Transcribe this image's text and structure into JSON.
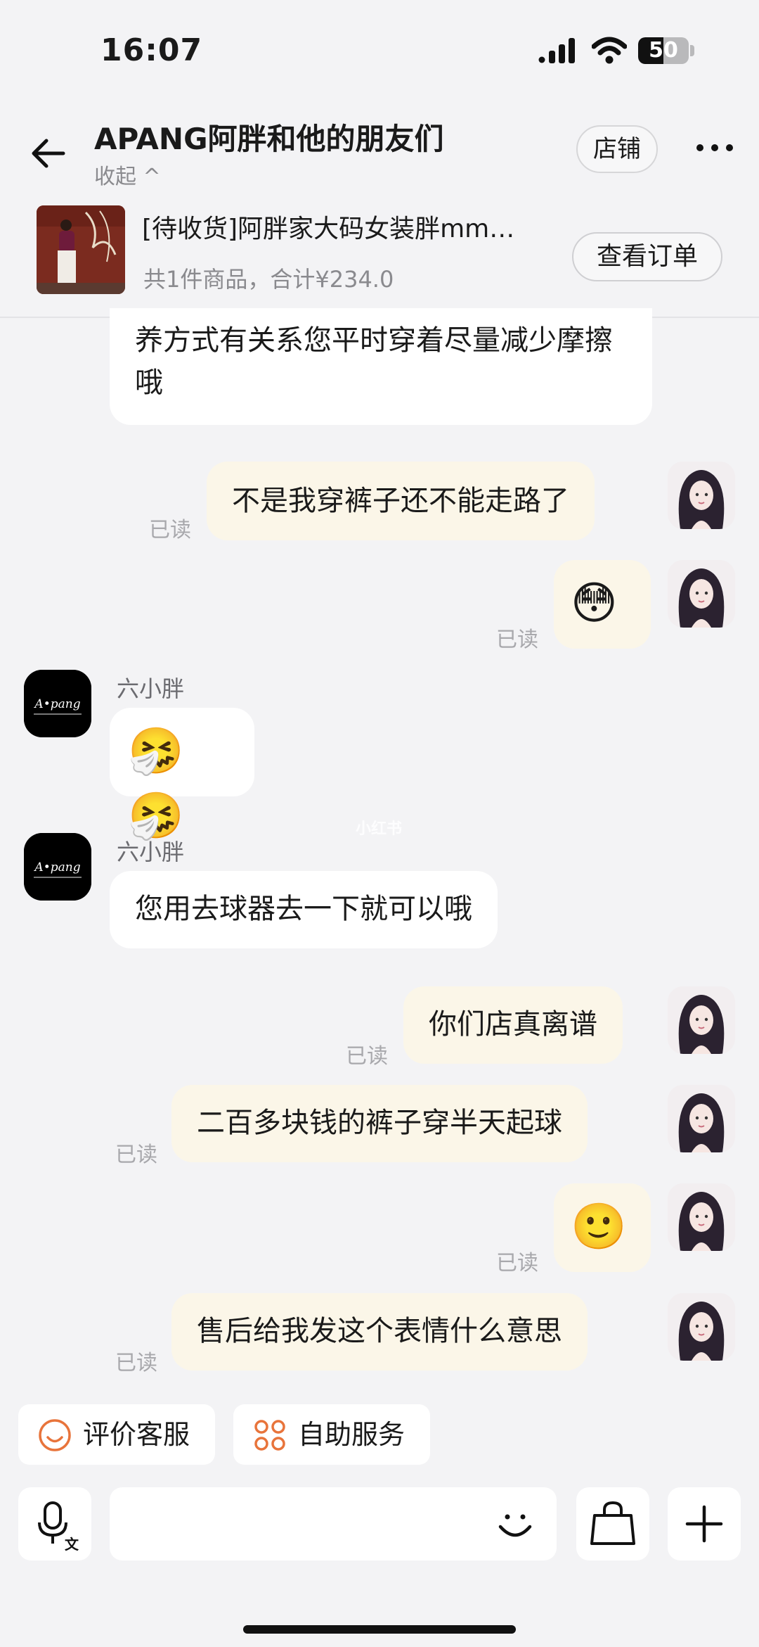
{
  "status": {
    "time": "16:07",
    "battery": "50",
    "battery_level": 0.5
  },
  "header": {
    "title": "APANG阿胖和他的朋友们",
    "collapse": "收起 ^",
    "store_button": "店铺"
  },
  "order": {
    "title": "[待收货]阿胖家大码女装胖mm…",
    "summary": "共1件商品，合计¥234.0",
    "view_button": "查看订单"
  },
  "messages": [
    {
      "side": "in",
      "text": "养方式有关系您平时穿着尽量减少摩擦哦"
    },
    {
      "side": "out",
      "text": "不是我穿裤子还不能走路了",
      "read": "已读"
    },
    {
      "side": "out",
      "emoji": "😳",
      "read": "已读"
    },
    {
      "side": "in",
      "sender": "六小胖",
      "emoji": "🤧🤧"
    },
    {
      "side": "in",
      "sender": "六小胖",
      "text": "您用去球器去一下就可以哦"
    },
    {
      "side": "out",
      "text": "你们店真离谱",
      "read": "已读"
    },
    {
      "side": "out",
      "text": "二百多块钱的裤子穿半天起球",
      "read": "已读"
    },
    {
      "side": "out",
      "emoji": "🙂",
      "read": "已读"
    },
    {
      "side": "out",
      "text": "售后给我发这个表情什么意思",
      "read": "已读"
    }
  ],
  "shop_logo_text": "A•pang",
  "watermark": "小红书",
  "quick_actions": [
    {
      "label": "评价客服",
      "icon": "smile-icon"
    },
    {
      "label": "自助服务",
      "icon": "grid-flower-icon"
    }
  ],
  "colors": {
    "accent": "#e8743b",
    "out_bubble": "#fbf6e8",
    "in_bubble": "#ffffff"
  }
}
